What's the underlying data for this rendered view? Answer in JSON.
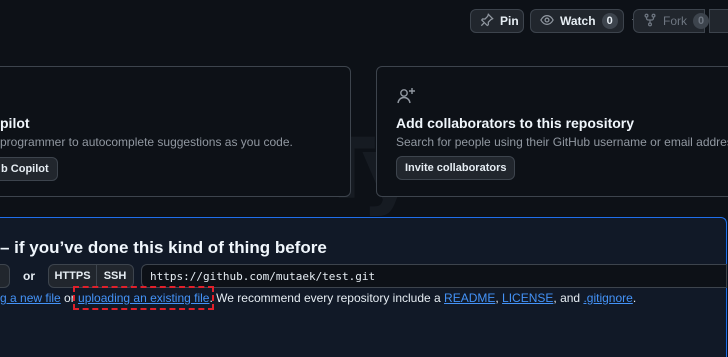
{
  "header": {
    "pin_label": "Pin",
    "watch_label": "Watch",
    "watch_count": "0",
    "fork_label": "Fork",
    "fork_count": "0"
  },
  "copilot_card": {
    "title": "pilot",
    "description": "programmer to autocomplete suggestions as you code.",
    "button_label": "b Copilot"
  },
  "collab_card": {
    "title": "Add collaborators to this repository",
    "description": "Search for people using their GitHub username or email address.",
    "button_label": "Invite collaborators"
  },
  "quick_setup": {
    "title": "– if you’ve done this kind of thing before",
    "or_label": "or",
    "https_label": "HTTPS",
    "ssh_label": "SSH",
    "clone_url": "https://github.com/mutaek/test.git",
    "help": {
      "new_file_link": "g a new file",
      "or_text": " or ",
      "upload_link": "uploading an existing file",
      "middle_text": ". We recommend every repository include a ",
      "readme_link": "README",
      "comma": ", ",
      "license_link": "LICENSE",
      "and_text": ", and ",
      "gitignore_link": ".gitignore",
      "end_text": "."
    }
  },
  "icons": {
    "pin": "pin-icon",
    "watch": "eye-icon",
    "fork": "fork-icon",
    "caret": "triangle-down-icon",
    "collab": "person-add-icon"
  }
}
